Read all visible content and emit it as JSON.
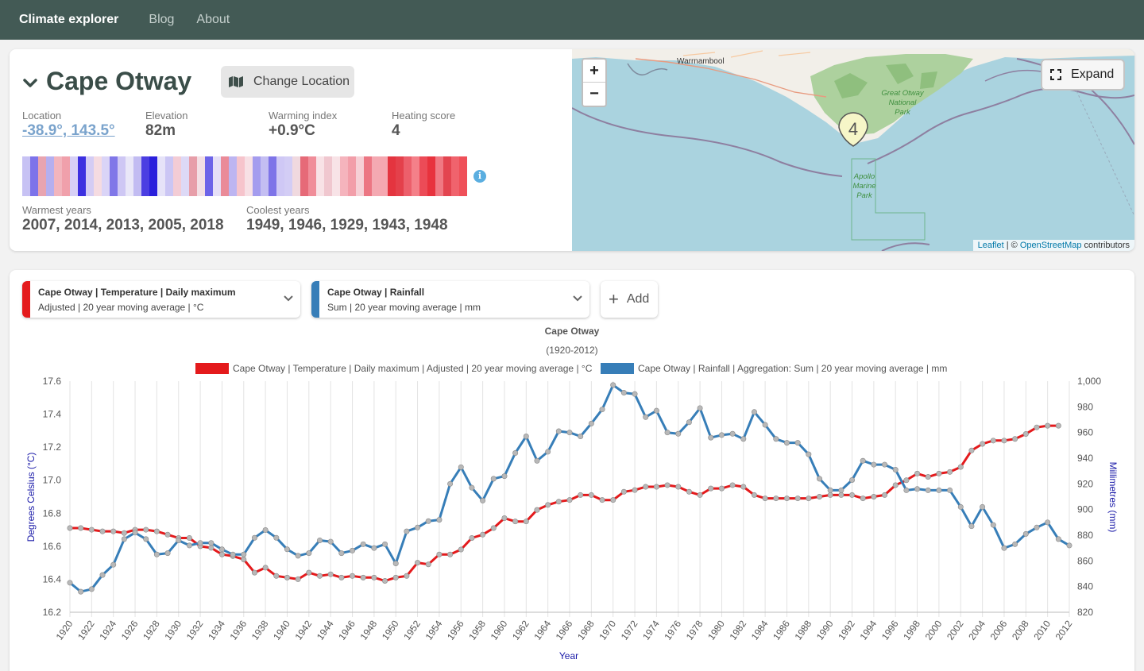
{
  "nav": {
    "brand": "Climate explorer",
    "links": [
      "Blog",
      "About"
    ]
  },
  "location": {
    "name": "Cape Otway",
    "change_label": "Change Location",
    "stats": {
      "location_label": "Location",
      "location_value": "-38.9°, 143.5°",
      "elevation_label": "Elevation",
      "elevation_value": "82m",
      "warming_label": "Warming index",
      "warming_value": "+0.9°C",
      "heating_label": "Heating score",
      "heating_value": "4"
    },
    "stripe_colors": [
      "#c7c2f4",
      "#7d73ea",
      "#e8a4b0",
      "#b5afef",
      "#f2b5bd",
      "#f0a0ab",
      "#d7d0f6",
      "#3c30e0",
      "#d4ccf4",
      "#f5dbe1",
      "#dad4f7",
      "#8077e8",
      "#cec7f4",
      "#e9e7f8",
      "#c2bcf2",
      "#4b3ee2",
      "#2a1fdc",
      "#e6e3f8",
      "#cbc6f4",
      "#f3ccd5",
      "#ddd9f6",
      "#e79ea9",
      "#f3dfe4",
      "#6d64e8",
      "#e6e0f7",
      "#ea8b98",
      "#bdb5f1",
      "#f6c4cc",
      "#f7e0e5",
      "#a49cee",
      "#c4bef2",
      "#7e74e8",
      "#cfc8f5",
      "#d3cdf5",
      "#f0d9df",
      "#e66a78",
      "#f08d99",
      "#f8e2e6",
      "#f0c7cf",
      "#f8e3e7",
      "#f5b4bd",
      "#f29ea9",
      "#f6d0d6",
      "#ec7683",
      "#f4a9b2",
      "#f5a7b0",
      "#e4343f",
      "#e4404b",
      "#ec5f6b",
      "#f48089",
      "#ec4b57",
      "#e8323d",
      "#f07983",
      "#e34550",
      "#f0636d",
      "#ef5059"
    ],
    "warmest_label": "Warmest years",
    "warmest_value": "2007, 2014, 2013, 2005, 2018",
    "coolest_label": "Coolest years",
    "coolest_value": "1949, 1946, 1929, 1943, 1948",
    "info_icon": "info-icon"
  },
  "map": {
    "labels": {
      "town": "Warrnambool",
      "park": [
        "Great Otway",
        "National",
        "Park"
      ],
      "marine": [
        "Apollo",
        "Marine",
        "Park"
      ],
      "cluster": "4"
    },
    "zoom_in": "+",
    "zoom_out": "−",
    "expand_label": "Expand",
    "attribution": {
      "leaflet": "Leaflet",
      "sep": " | © ",
      "osm": "OpenStreetMap",
      "tail": " contributors"
    }
  },
  "series_selectors": [
    {
      "title": "Cape Otway | Temperature | Daily maximum",
      "subtitle": "Adjusted | 20 year moving average | °C",
      "color": "#e41a1c"
    },
    {
      "title": "Cape Otway | Rainfall",
      "subtitle": "Sum | 20 year moving average | mm",
      "color": "#377eb8"
    }
  ],
  "add_label": "Add",
  "chart_data": {
    "type": "line",
    "title": "Cape Otway",
    "subtitle": "(1920-2012)",
    "xlabel": "Year",
    "ylabel_left": "Degrees Celsius (°C)",
    "ylabel_right": "Millimetres (mm)",
    "x_start": 1920,
    "x_end": 2012,
    "x_ticks": [
      1920,
      1922,
      1924,
      1926,
      1928,
      1930,
      1932,
      1934,
      1936,
      1938,
      1940,
      1942,
      1944,
      1946,
      1948,
      1950,
      1952,
      1954,
      1956,
      1958,
      1960,
      1962,
      1964,
      1966,
      1968,
      1970,
      1972,
      1974,
      1976,
      1978,
      1980,
      1982,
      1984,
      1986,
      1988,
      1990,
      1992,
      1994,
      1996,
      1998,
      2000,
      2002,
      2004,
      2006,
      2008,
      2010,
      2012
    ],
    "ylim_left": [
      16.2,
      17.6
    ],
    "yticks_left": [
      "17.6",
      "17.4",
      "17.2",
      "17.0",
      "16.8",
      "16.6",
      "16.4",
      "16.2"
    ],
    "ylim_right": [
      820,
      1000
    ],
    "yticks_right": [
      "1,000",
      "980",
      "960",
      "940",
      "920",
      "900",
      "880",
      "860",
      "840",
      "820"
    ],
    "series": [
      {
        "name": "Cape Otway | Temperature | Daily maximum | Adjusted | 20 year moving average | °C",
        "color": "#e41a1c",
        "axis": "left",
        "x": [
          1920,
          1921,
          1922,
          1923,
          1924,
          1925,
          1926,
          1927,
          1928,
          1929,
          1930,
          1931,
          1932,
          1933,
          1934,
          1935,
          1936,
          1937,
          1938,
          1939,
          1940,
          1941,
          1942,
          1943,
          1944,
          1945,
          1946,
          1947,
          1948,
          1949,
          1950,
          1951,
          1952,
          1953,
          1954,
          1955,
          1956,
          1957,
          1958,
          1959,
          1960,
          1961,
          1962,
          1963,
          1964,
          1965,
          1966,
          1967,
          1968,
          1969,
          1970,
          1971,
          1972,
          1973,
          1974,
          1975,
          1976,
          1977,
          1978,
          1979,
          1980,
          1981,
          1982,
          1983,
          1984,
          1985,
          1986,
          1987,
          1988,
          1989,
          1990,
          1991,
          1992,
          1993,
          1994,
          1995,
          1996,
          1997,
          1998,
          1999,
          2000,
          2001,
          2002,
          2003,
          2004,
          2005,
          2006,
          2007,
          2008,
          2009,
          2010,
          2011
        ],
        "values": [
          16.71,
          16.71,
          16.7,
          16.69,
          16.69,
          16.68,
          16.7,
          16.7,
          16.69,
          16.67,
          16.65,
          16.65,
          16.6,
          16.59,
          16.55,
          16.54,
          16.52,
          16.44,
          16.47,
          16.42,
          16.41,
          16.4,
          16.44,
          16.42,
          16.43,
          16.41,
          16.42,
          16.41,
          16.41,
          16.39,
          16.41,
          16.42,
          16.5,
          16.49,
          16.55,
          16.55,
          16.58,
          16.65,
          16.67,
          16.71,
          16.77,
          16.75,
          16.75,
          16.82,
          16.85,
          16.87,
          16.88,
          16.91,
          16.91,
          16.88,
          16.88,
          16.93,
          16.94,
          16.96,
          16.96,
          16.97,
          16.96,
          16.93,
          16.91,
          16.95,
          16.95,
          16.97,
          16.96,
          16.91,
          16.89,
          16.89,
          16.89,
          16.89,
          16.89,
          16.9,
          16.91,
          16.91,
          16.91,
          16.89,
          16.9,
          16.91,
          16.97,
          17.0,
          17.04,
          17.02,
          17.04,
          17.05,
          17.08,
          17.18,
          17.22,
          17.24,
          17.24,
          17.25,
          17.28,
          17.32,
          17.33,
          17.33
        ]
      },
      {
        "name": "Cape Otway | Rainfall | Aggregation: Sum | 20 year moving average | mm",
        "color": "#377eb8",
        "axis": "right",
        "x": [
          1920,
          1921,
          1922,
          1923,
          1924,
          1925,
          1926,
          1927,
          1928,
          1929,
          1930,
          1931,
          1932,
          1933,
          1934,
          1935,
          1936,
          1937,
          1938,
          1939,
          1940,
          1941,
          1942,
          1943,
          1944,
          1945,
          1946,
          1947,
          1948,
          1949,
          1950,
          1951,
          1952,
          1953,
          1954,
          1955,
          1956,
          1957,
          1958,
          1959,
          1960,
          1961,
          1962,
          1963,
          1964,
          1965,
          1966,
          1967,
          1968,
          1969,
          1970,
          1971,
          1972,
          1973,
          1974,
          1975,
          1976,
          1977,
          1978,
          1979,
          1980,
          1981,
          1982,
          1983,
          1984,
          1985,
          1986,
          1987,
          1988,
          1989,
          1990,
          1991,
          1992,
          1993,
          1994,
          1995,
          1996,
          1997,
          1998,
          1999,
          2000,
          2001,
          2002,
          2003,
          2004,
          2005,
          2006,
          2007,
          2008,
          2009,
          2010,
          2011,
          2012
        ],
        "values": [
          843,
          836,
          838,
          849,
          857,
          877,
          882,
          877,
          865,
          866,
          876,
          872,
          874,
          874,
          869,
          865,
          865,
          878,
          884,
          878,
          869,
          864,
          866,
          876,
          875,
          866,
          868,
          873,
          870,
          873,
          858,
          883,
          886,
          891,
          892,
          920,
          933,
          917,
          907,
          924,
          926,
          944,
          957,
          938,
          945,
          961,
          960,
          957,
          967,
          978,
          997,
          991,
          990,
          972,
          977,
          960,
          959,
          968,
          979,
          956,
          958,
          959,
          955,
          976,
          966,
          955,
          952,
          952,
          943,
          924,
          915,
          915,
          923,
          938,
          935,
          935,
          931,
          915,
          916,
          915,
          915,
          915,
          902,
          887,
          902,
          888,
          870,
          873,
          881,
          886,
          890,
          877,
          872
        ]
      }
    ]
  }
}
